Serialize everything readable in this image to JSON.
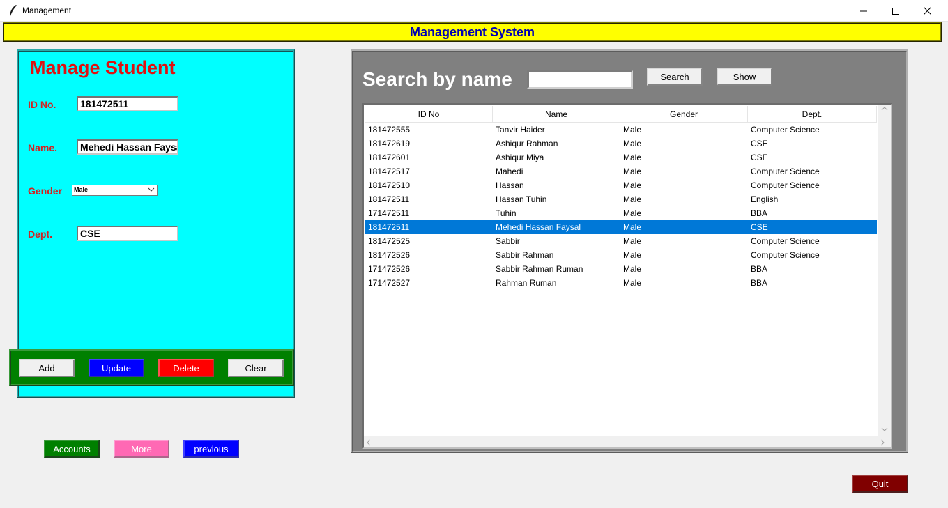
{
  "window": {
    "title": "Management"
  },
  "banner": {
    "title": "Management System"
  },
  "form": {
    "heading": "Manage Student",
    "id_label": "ID No.",
    "id_value": "181472511",
    "name_label": "Name.",
    "name_value": "Mehedi Hassan Faysal",
    "gender_label": "Gender",
    "gender_value": "Male",
    "dept_label": "Dept.",
    "dept_value": "CSE"
  },
  "actions": {
    "add": "Add",
    "update": "Update",
    "delete": "Delete",
    "clear": "Clear"
  },
  "nav": {
    "accounts": "Accounts",
    "more": "More",
    "previous": "previous"
  },
  "search": {
    "label": "Search by name",
    "value": "",
    "search_button": "Search",
    "show_button": "Show"
  },
  "table": {
    "columns": [
      "ID No",
      "Name",
      "Gender",
      "Dept."
    ],
    "selected_index": 7,
    "rows": [
      [
        "181472555",
        "Tanvir Haider",
        "Male",
        "Computer Science"
      ],
      [
        "181472619",
        "Ashiqur Rahman",
        "Male",
        "CSE"
      ],
      [
        "181472601",
        "Ashiqur Miya",
        "Male",
        "CSE"
      ],
      [
        "181472517",
        "Mahedi",
        "Male",
        "Computer Science"
      ],
      [
        "181472510",
        "Hassan",
        "Male",
        "Computer Science"
      ],
      [
        "181472511",
        "Hassan Tuhin",
        "Male",
        "English"
      ],
      [
        "171472511",
        "Tuhin",
        "Male",
        "BBA"
      ],
      [
        "181472511",
        "Mehedi Hassan Faysal",
        "Male",
        "CSE"
      ],
      [
        "181472525",
        "Sabbir",
        "Male",
        "Computer Science"
      ],
      [
        "181472526",
        "Sabbir Rahman",
        "Male",
        "Computer Science"
      ],
      [
        "171472526",
        "Sabbir Rahman Ruman",
        "Male",
        "BBA"
      ],
      [
        "171472527",
        "Rahman Ruman",
        "Male",
        "BBA"
      ]
    ]
  },
  "quit": "Quit",
  "colors": {
    "banner_bg": "#ffff00",
    "banner_text": "#0000b4",
    "form_bg": "#00ffff",
    "form_heading": "#e01010",
    "button_frame": "#008000",
    "selection": "#0078d7",
    "quit_bg": "#800000"
  },
  "icons": [
    "feather-app-icon",
    "minimize-icon",
    "maximize-icon",
    "close-icon",
    "chevron-down-icon",
    "scroll-up-icon",
    "scroll-down-icon",
    "scroll-left-icon",
    "scroll-right-icon"
  ]
}
